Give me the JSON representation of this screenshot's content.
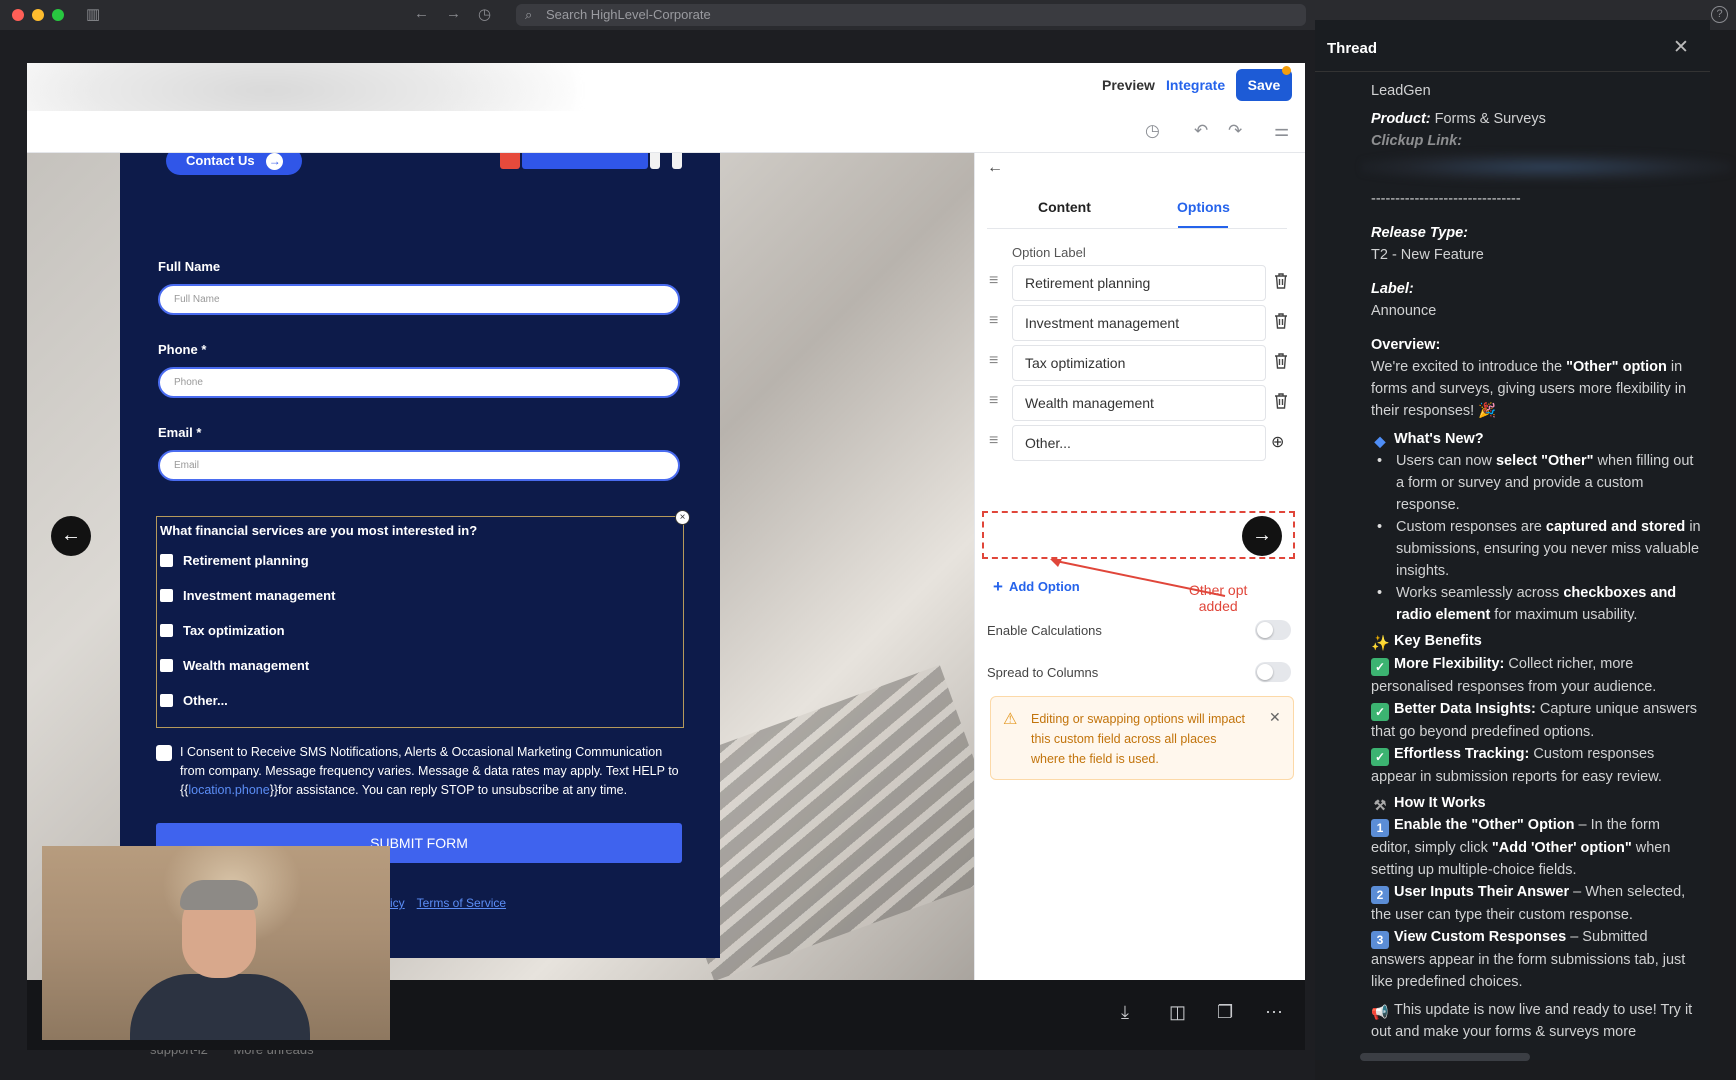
{
  "window": {
    "search_placeholder": "Search HighLevel-Corporate",
    "help": "?"
  },
  "editor": {
    "preview": "Preview",
    "integrate": "Integrate",
    "save": "Save"
  },
  "form": {
    "contact_us": "Contact Us",
    "fields": [
      {
        "label": "Full Name",
        "placeholder": "Full Name",
        "required": ""
      },
      {
        "label": "Phone",
        "placeholder": "Phone",
        "required": "*"
      },
      {
        "label": "Email",
        "placeholder": "Email",
        "required": "*"
      }
    ],
    "question": "What financial services are you most interested in?",
    "options": [
      "Retirement planning",
      "Investment management",
      "Tax optimization",
      "Wealth management",
      "Other..."
    ],
    "consent_pre": "I Consent to Receive SMS Notifications, Alerts & Occasional Marketing Communication from company. Message frequency varies. Message & data rates may apply. Text HELP to {{",
    "consent_link": "location.phone",
    "consent_post": "}}for assistance. You can reply STOP to unsubscribe at any time.",
    "submit": "SUBMIT FORM",
    "policy": "icy",
    "terms": "Terms of Service"
  },
  "panel": {
    "tabs": [
      "Content",
      "Options"
    ],
    "active_tab": "Options",
    "option_label_header": "Option Label",
    "options": [
      "Retirement planning",
      "Investment management",
      "Tax optimization",
      "Wealth management",
      "Other..."
    ],
    "add_option": "Add Option",
    "annotation": "Other opt\nadded",
    "enable_calculations": "Enable Calculations",
    "enable_calculations_on": false,
    "spread_to_columns": "Spread to Columns",
    "spread_to_columns_on": false,
    "warning": "Editing or swapping options will impact this custom field across all places where the field is used."
  },
  "slack": {
    "channel": "support-l2",
    "more_unreads": "More unreads"
  },
  "thread": {
    "title": "Thread",
    "org": "LeadGen",
    "product_label": "Product:",
    "product_value": "Forms & Surveys",
    "clickup_label": "Clickup Link:",
    "divider": "-------------------------------",
    "release_type_label": "Release Type:",
    "release_type_value": "T2 - New Feature",
    "label_label": "Label:",
    "label_value": "Announce",
    "overview_label": "Overview:",
    "overview_pre": "We're excited to introduce the ",
    "overview_bold": "\"Other\" option",
    "overview_post": " in forms and surveys, giving users more flexibility in their responses! 🎉",
    "whats_new": "What's New?",
    "bullets": [
      {
        "pre": "Users can now ",
        "bold": "select \"Other\"",
        "post": " when filling out a form or survey and provide a custom response."
      },
      {
        "pre": "Custom responses are ",
        "bold": "captured and stored",
        "post": " in submissions, ensuring you never miss valuable insights."
      },
      {
        "pre": "Works seamlessly across ",
        "bold": "checkboxes and radio element",
        "post": " for maximum usability."
      }
    ],
    "key_benefits": "Key Benefits",
    "benefits": [
      {
        "bold": "More Flexibility:",
        "text": " Collect richer, more personalised responses from your audience."
      },
      {
        "bold": "Better Data Insights:",
        "text": " Capture unique answers that go beyond predefined options."
      },
      {
        "bold": "Effortless Tracking:",
        "text": " Custom responses appear in submission reports for easy review."
      }
    ],
    "how_it_works": "How It Works",
    "steps": [
      {
        "num": "1",
        "bold": "Enable the \"Other\" Option",
        "text": " – In the form editor, simply click ",
        "bold2": "\"Add 'Other' option\"",
        "text2": " when setting up multiple-choice fields."
      },
      {
        "num": "2",
        "bold": "User Inputs Their Answer",
        "text": " – When selected, the user can type their custom response.",
        "bold2": "",
        "text2": ""
      },
      {
        "num": "3",
        "bold": "View Custom Responses",
        "text": " – Submitted answers appear in the form submissions tab, just like predefined choices.",
        "bold2": "",
        "text2": ""
      }
    ],
    "closing": "This update is now live and ready to use! Try it out and make your forms & surveys more"
  },
  "colors": {
    "accent": "#2563eb",
    "form_bg": "#0d1b4a",
    "annotation": "#e0463a"
  }
}
